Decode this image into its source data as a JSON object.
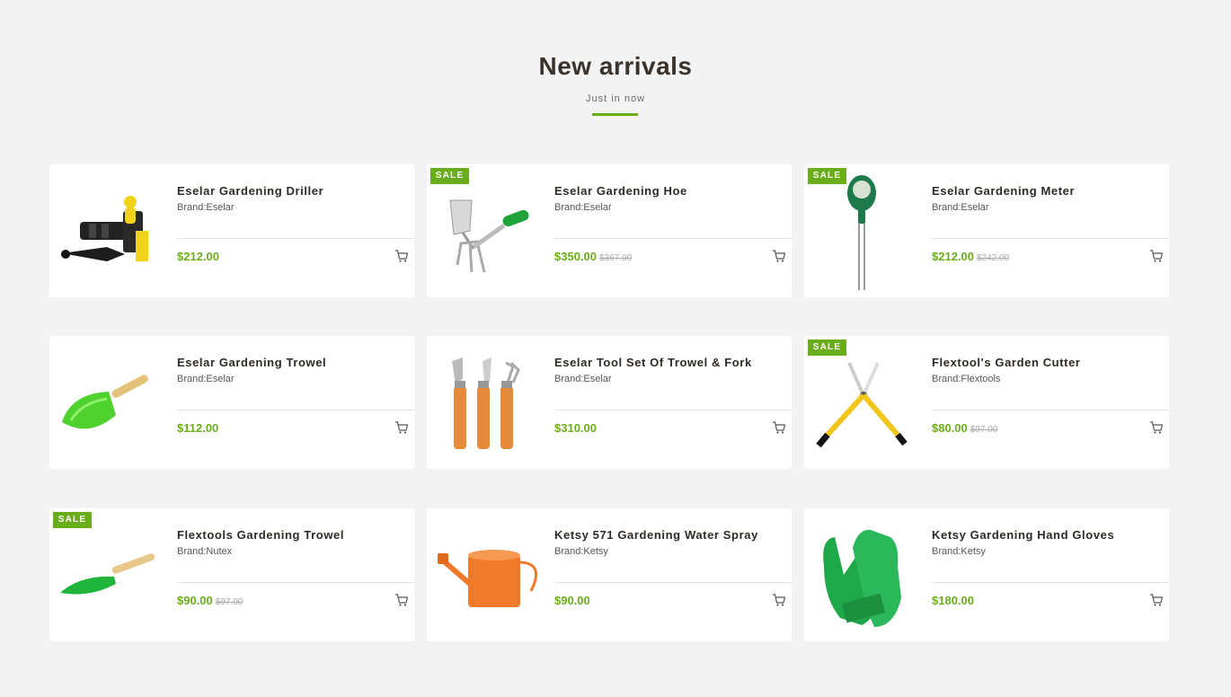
{
  "section": {
    "title": "New arrivals",
    "subtitle": "Just in now",
    "accent_color": "#6aad1a"
  },
  "sale_label": "SALE",
  "products": [
    {
      "name": "Eselar Gardening Driller",
      "brand": "Brand:Eselar",
      "price": "$212.00",
      "old_price": "",
      "sale": false,
      "image": "driller"
    },
    {
      "name": "Eselar Gardening Hoe",
      "brand": "Brand:Eselar",
      "price": "$350.00",
      "old_price": "$367.00",
      "sale": true,
      "image": "hoe"
    },
    {
      "name": "Eselar Gardening Meter",
      "brand": "Brand:Eselar",
      "price": "$212.00",
      "old_price": "$242.00",
      "sale": true,
      "image": "meter"
    },
    {
      "name": "Eselar Gardening Trowel",
      "brand": "Brand:Eselar",
      "price": "$112.00",
      "old_price": "",
      "sale": false,
      "image": "trowel-scoop"
    },
    {
      "name": "Eselar Tool Set Of Trowel & Fork",
      "brand": "Brand:Eselar",
      "price": "$310.00",
      "old_price": "",
      "sale": false,
      "image": "tool-set"
    },
    {
      "name": "Flextool's Garden Cutter",
      "brand": "Brand:Flextools",
      "price": "$80.00",
      "old_price": "$97.00",
      "sale": true,
      "image": "cutter"
    },
    {
      "name": "Flextools Gardening Trowel",
      "brand": "Brand:Nutex",
      "price": "$90.00",
      "old_price": "$97.00",
      "sale": true,
      "image": "trowel-flat"
    },
    {
      "name": "Ketsy 571 Gardening Water Spray",
      "brand": "Brand:Ketsy",
      "price": "$90.00",
      "old_price": "",
      "sale": false,
      "image": "watering-can"
    },
    {
      "name": "Ketsy Gardening Hand Gloves",
      "brand": "Brand:Ketsy",
      "price": "$180.00",
      "old_price": "",
      "sale": false,
      "image": "gloves"
    }
  ]
}
